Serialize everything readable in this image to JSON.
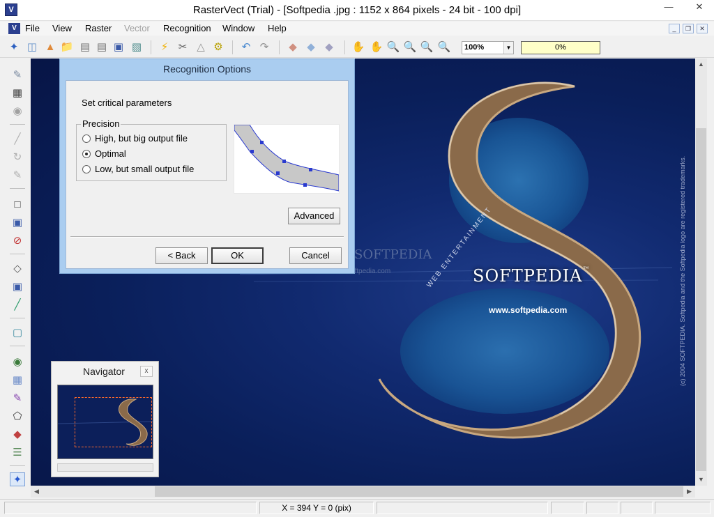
{
  "window": {
    "title": "RasterVect (Trial) - [Softpedia .jpg : 1152 x 864 pixels - 24 bit - 100 dpi]",
    "app_icon": "rastervect-logo-icon"
  },
  "menu": {
    "items": [
      {
        "label": "File",
        "enabled": true
      },
      {
        "label": "View",
        "enabled": true
      },
      {
        "label": "Raster",
        "enabled": true
      },
      {
        "label": "Vector",
        "enabled": false
      },
      {
        "label": "Recognition",
        "enabled": true
      },
      {
        "label": "Window",
        "enabled": true
      },
      {
        "label": "Help",
        "enabled": true
      }
    ]
  },
  "toolbar": {
    "zoom_value": "100%",
    "progress_text": "0%",
    "progress_color": "#ffffc8"
  },
  "dialog": {
    "title": "Recognition Options",
    "subtitle": "Set critical parameters",
    "group_title": "Precision",
    "options": [
      {
        "label": "High, but big output file",
        "checked": false
      },
      {
        "label": "Optimal",
        "checked": true
      },
      {
        "label": "Low, but small output file",
        "checked": false
      }
    ],
    "advanced_label": "Advanced",
    "back_label": "< Back",
    "ok_label": "OK",
    "cancel_label": "Cancel",
    "title_bar_color": "#aacdf0"
  },
  "canvas_image": {
    "brand_text": "SOFTPEDIA",
    "trademark": "™",
    "url_text": "www.softpedia.com",
    "tagline": "WEB ENTERTAINMENT",
    "copyright_text": "(c) 2004 SOFTPEDIA. Softpedia and the Softpedia logo are registered trademarks.",
    "watermark_text": "SOFTPEDIA",
    "watermark_url": "www.softpedia.com"
  },
  "navigator": {
    "title": "Navigator",
    "close_label": "x"
  },
  "status": {
    "coordinates": "X = 394   Y = 0 (pix)"
  }
}
